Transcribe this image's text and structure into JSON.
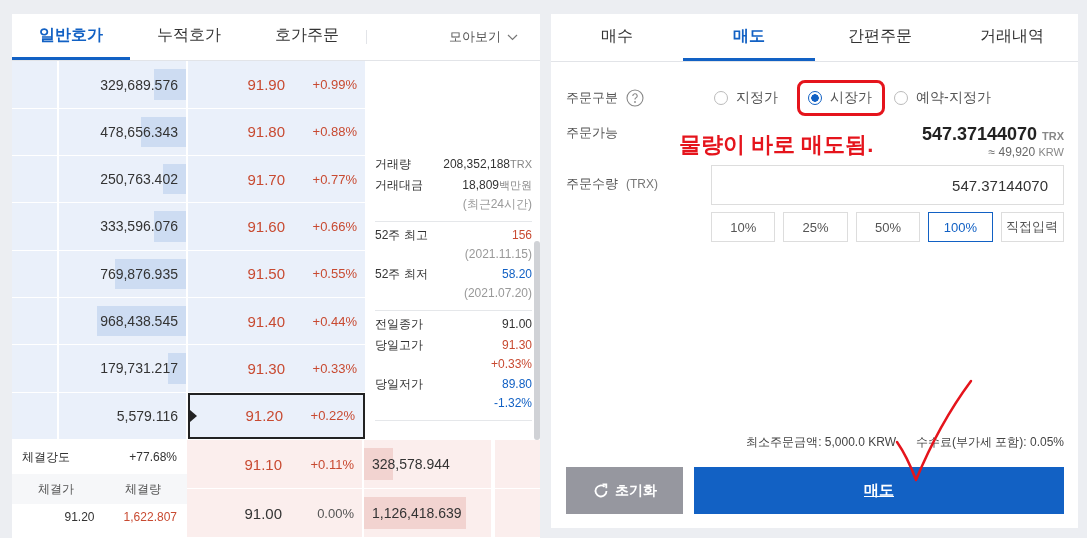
{
  "orderbook": {
    "tabs": [
      {
        "label": "일반호가",
        "selected": true
      },
      {
        "label": "누적호가",
        "selected": false
      },
      {
        "label": "호가주문",
        "selected": false
      }
    ],
    "view_toggle": "모아보기",
    "asks": [
      {
        "quantity": "329,689.576",
        "level": 0.25,
        "price": "91.90",
        "change": "+0.99%",
        "color": "#c84a31",
        "current": false
      },
      {
        "quantity": "478,656.343",
        "level": 0.35,
        "price": "91.80",
        "change": "+0.88%",
        "color": "#c84a31",
        "current": false
      },
      {
        "quantity": "250,763.402",
        "level": 0.18,
        "price": "91.70",
        "change": "+0.77%",
        "color": "#c84a31",
        "current": false
      },
      {
        "quantity": "333,596.076",
        "level": 0.25,
        "price": "91.60",
        "change": "+0.66%",
        "color": "#c84a31",
        "current": false
      },
      {
        "quantity": "769,876.935",
        "level": 0.56,
        "price": "91.50",
        "change": "+0.55%",
        "color": "#c84a31",
        "current": false
      },
      {
        "quantity": "968,438.545",
        "level": 0.7,
        "price": "91.40",
        "change": "+0.44%",
        "color": "#c84a31",
        "current": false
      },
      {
        "quantity": "179,731.217",
        "level": 0.14,
        "price": "91.30",
        "change": "+0.33%",
        "color": "#c84a31",
        "current": false
      },
      {
        "quantity": "5,579.116",
        "price": "91.20",
        "change": "+0.22%",
        "color": "#c84a31",
        "current": true
      }
    ],
    "bids": [
      {
        "price": "91.10",
        "change": "+0.11%",
        "color": "#c84a31",
        "quantity": "328,578.944",
        "level": 0.23
      },
      {
        "price": "91.00",
        "change": "0.00%",
        "color": "#333333",
        "quantity": "1,126,418.639",
        "level": 0.8
      }
    ],
    "market_info": [
      [
        {
          "label": "거래량",
          "value": "208,352,188",
          "unit": "TRX",
          "color": "#333333"
        },
        {
          "label": "거래대금",
          "value": "18,809",
          "unit": "백만원",
          "color": "#333333",
          "note": "(최근24시간)"
        }
      ],
      [
        {
          "label": "52주 최고",
          "value": "156",
          "color": "#c84a31",
          "note": "(2021.11.15)"
        },
        {
          "label": "52주 최저",
          "value": "58.20",
          "color": "#1261c4",
          "note": "(2021.07.20)"
        }
      ],
      [
        {
          "label": "전일종가",
          "value": "91.00",
          "color": "#333333"
        },
        {
          "label": "당일고가",
          "value": "91.30",
          "color": "#c84a31",
          "change": "+0.33%"
        },
        {
          "label": "당일저가",
          "value": "89.80",
          "color": "#1261c4",
          "change": "-1.32%"
        }
      ]
    ],
    "trade_strength": {
      "label": "체결강도",
      "value": "+77.68%"
    },
    "trades": {
      "columns": [
        "체결가",
        "체결량"
      ],
      "rows": [
        {
          "price": "91.20",
          "volume": "1,622.807",
          "color": "#c84a31"
        }
      ]
    }
  },
  "order_panel": {
    "tabs": [
      {
        "label": "매수",
        "selected": false
      },
      {
        "label": "매도",
        "selected": true
      },
      {
        "label": "간편주문",
        "selected": false
      },
      {
        "label": "거래내역",
        "selected": false
      }
    ],
    "order_type": {
      "label": "주문구분",
      "options": [
        {
          "label": "지정가",
          "selected": false,
          "annotated": false
        },
        {
          "label": "시장가",
          "selected": true,
          "annotated": true
        },
        {
          "label": "예약-지정가",
          "selected": false,
          "annotated": false
        }
      ]
    },
    "available": {
      "label": "주문가능",
      "amount": "547.37144070",
      "unit": "TRX",
      "approx": "≈ 49,920",
      "approx_unit": "KRW"
    },
    "quantity": {
      "label": "주문수량",
      "unit": "(TRX)",
      "value": "547.37144070"
    },
    "percent_buttons": [
      {
        "label": "10%",
        "selected": false
      },
      {
        "label": "25%",
        "selected": false
      },
      {
        "label": "50%",
        "selected": false
      },
      {
        "label": "100%",
        "selected": true
      },
      {
        "label": "직접입력",
        "selected": false
      }
    ],
    "notes": [
      "최소주문금액: 5,000.0 KRW",
      "수수료(부가세 포함): 0.05%"
    ],
    "reset_button": "초기화",
    "submit_button": "매도"
  },
  "annotation": {
    "text": "물량이 바로 매도됨."
  }
}
